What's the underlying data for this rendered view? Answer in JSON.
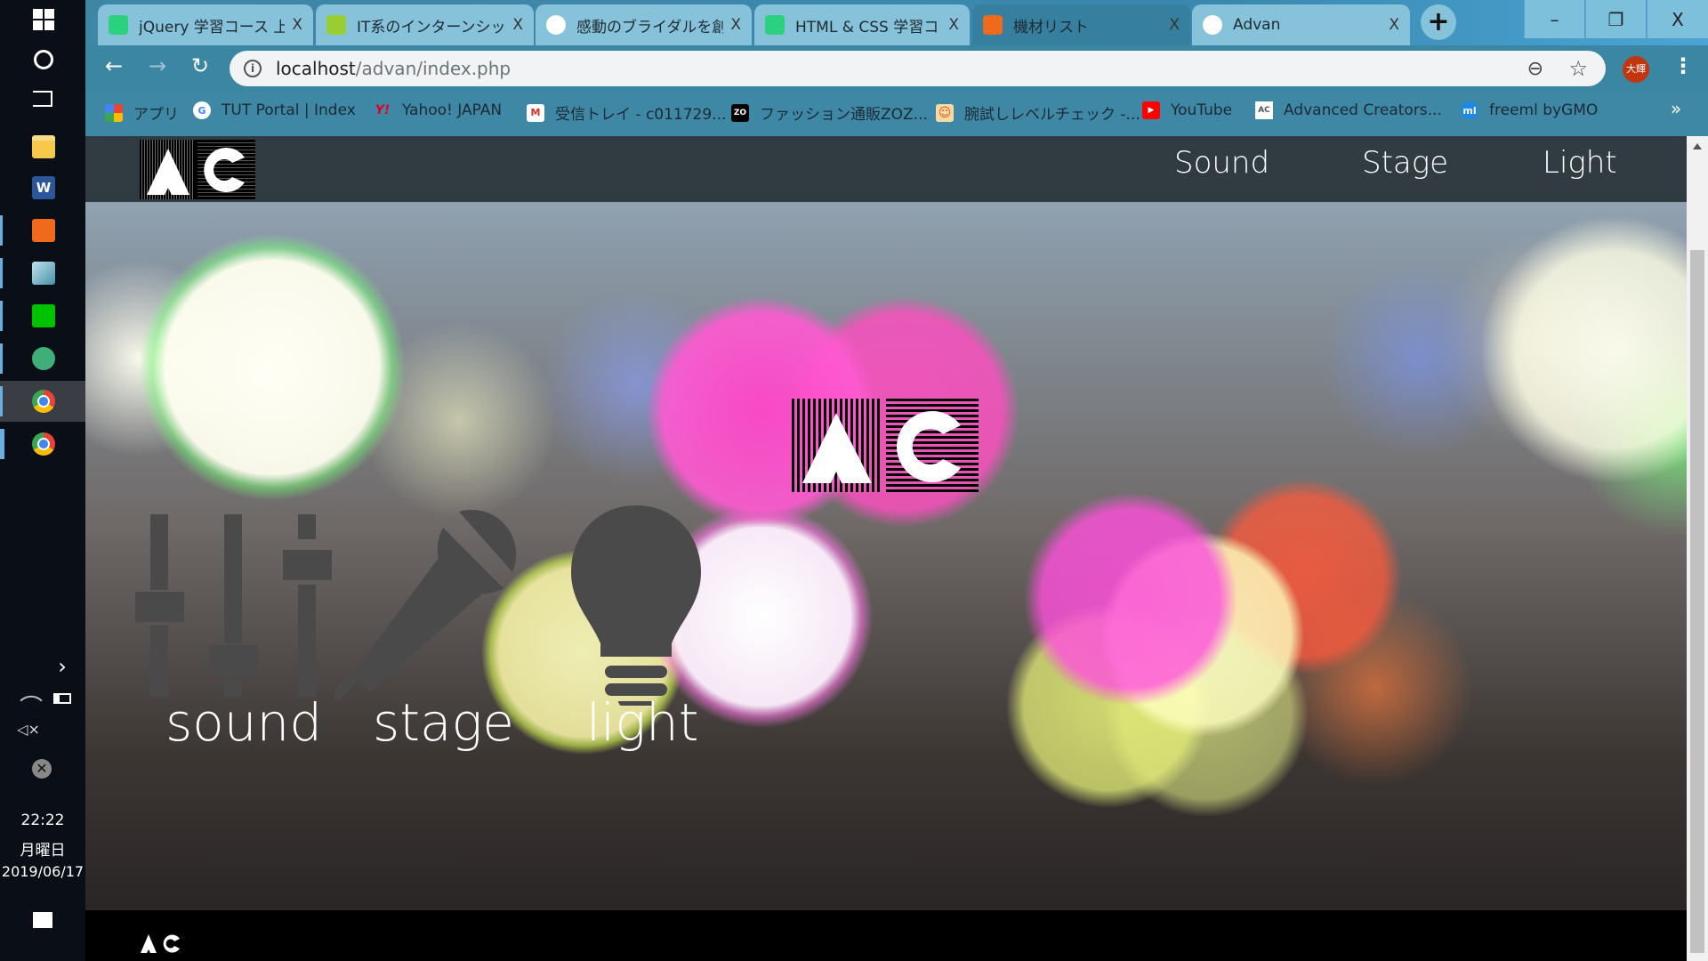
{
  "taskbar": {
    "time": "22:22",
    "day": "月曜日",
    "date": "2019/06/17"
  },
  "browser": {
    "tabs": [
      {
        "title": "jQuery 学習コース 上",
        "color": "#2bd17e"
      },
      {
        "title": "IT系のインターンシップ",
        "color": "#9acd32"
      },
      {
        "title": "感動のブライダルを創",
        "color": "#ffffff"
      },
      {
        "title": "HTML & CSS 学習コ",
        "color": "#2bd17e"
      },
      {
        "title": "機材リスト",
        "color": "#f06a1c"
      },
      {
        "title": "Advan",
        "color": "#ffffff"
      }
    ],
    "close_glyph": "X",
    "new_tab": "+",
    "window": {
      "minimize": "–",
      "restore": "❐",
      "close": "X"
    },
    "url_host": "localhost",
    "url_path": "/advan/index.php",
    "profile": "大輝",
    "bookmarks": [
      {
        "label": "アプリ"
      },
      {
        "label": "TUT Portal | Index",
        "icon": "G"
      },
      {
        "label": "Yahoo! JAPAN",
        "icon": "Y!"
      },
      {
        "label": "受信トレイ - c011729...",
        "icon": "M"
      },
      {
        "label": "ファッション通販ZOZ...",
        "icon": "ZO"
      },
      {
        "label": "腕試しレベルチェック -...",
        "icon": "☺"
      },
      {
        "label": "YouTube",
        "icon": "▶"
      },
      {
        "label": "Advanced Creators...",
        "icon": "AC"
      },
      {
        "label": "freeml byGMO",
        "icon": "ml"
      }
    ],
    "more": "»"
  },
  "site": {
    "logo": "AC",
    "nav": [
      "Sound",
      "Stage",
      "Light"
    ],
    "categories": [
      "sound",
      "stage",
      "light"
    ],
    "footer_logo": "AC",
    "accent": "#ff5fd2"
  }
}
